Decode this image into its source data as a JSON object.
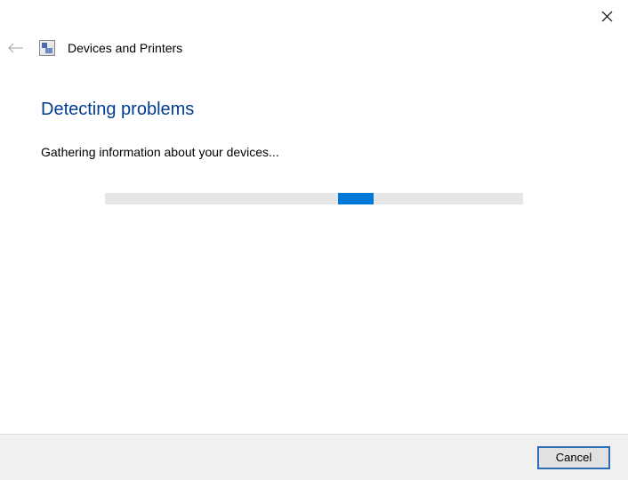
{
  "window": {
    "title": "Devices and Printers"
  },
  "content": {
    "heading": "Detecting problems",
    "status": "Gathering information about your devices..."
  },
  "footer": {
    "cancel_label": "Cancel"
  }
}
